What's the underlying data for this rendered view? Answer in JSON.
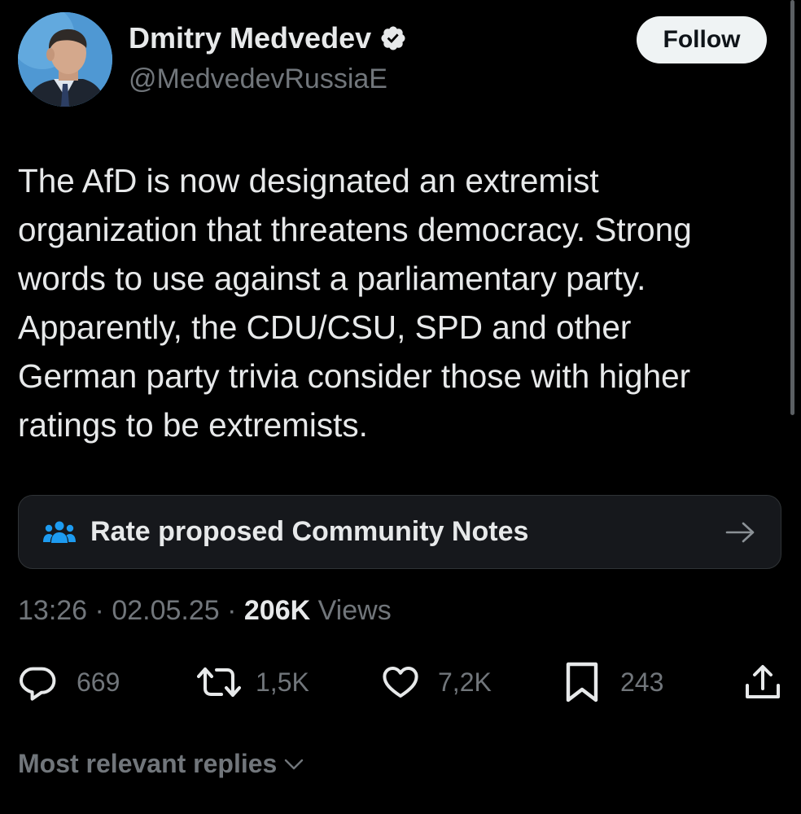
{
  "author": {
    "name": "Dmitry Medvedev",
    "handle": "@MedvedevRussiaE",
    "verified": true,
    "avatar_icon": "person-avatar",
    "verified_icon": "verified-badge-icon"
  },
  "follow_button": {
    "label": "Follow"
  },
  "tweet": {
    "lines": [
      "The AfD is now designated an extremist",
      "organization that threatens democracy. Strong",
      "words to use against a parliamentary party.",
      "Apparently, the CDU/CSU, SPD and other",
      "German party trivia consider those with higher",
      "ratings to be extremists."
    ]
  },
  "community_notes": {
    "label": "Rate proposed Community Notes",
    "icon": "people-group-icon",
    "arrow_icon": "arrow-right-icon",
    "icon_color": "#1d9bf0"
  },
  "meta": {
    "time": "13:26",
    "separator1": " · ",
    "date": "02.05.25",
    "separator2": " · ",
    "views_count": "206K",
    "views_label": " Views"
  },
  "actions": {
    "replies": {
      "icon": "reply-icon",
      "count": "669"
    },
    "reposts": {
      "icon": "repost-icon",
      "count": "1,5K"
    },
    "likes": {
      "icon": "heart-icon",
      "count": "7,2K"
    },
    "bookmarks": {
      "icon": "bookmark-icon",
      "count": "243"
    },
    "share": {
      "icon": "share-icon"
    }
  },
  "replies_filter": {
    "label": "Most relevant replies",
    "icon": "chevron-down-icon"
  },
  "colors": {
    "background": "#000000",
    "primary_text": "#e7e9ea",
    "secondary_text": "#71767b",
    "accent_blue": "#1d9bf0",
    "card_background": "#16181c",
    "follow_button_bg": "#eff3f4"
  }
}
